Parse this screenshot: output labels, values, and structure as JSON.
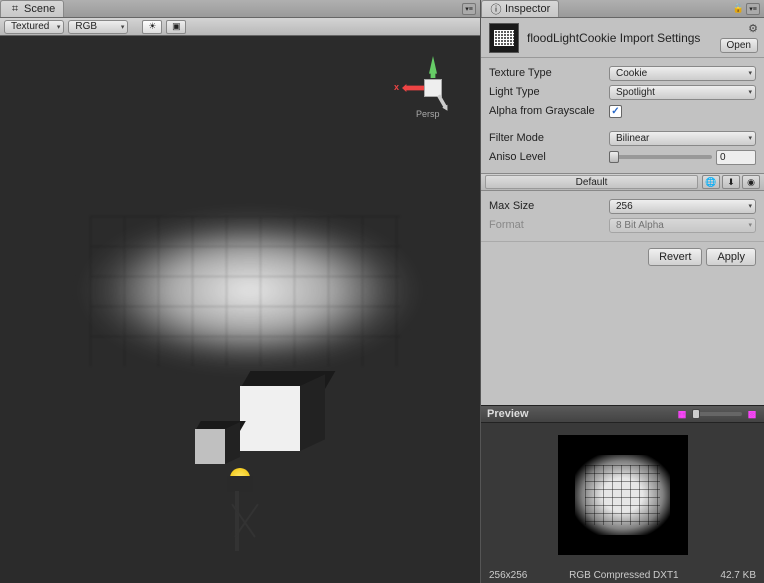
{
  "scene": {
    "tab_label": "Scene",
    "render_mode": "Textured",
    "color_mode": "RGB",
    "gizmo_label": "Persp",
    "gizmo_x": "x"
  },
  "inspector": {
    "tab_label": "Inspector",
    "asset_name": "floodLightCookie Import Settings",
    "open_label": "Open",
    "fields": {
      "texture_type": {
        "label": "Texture Type",
        "value": "Cookie"
      },
      "light_type": {
        "label": "Light Type",
        "value": "Spotlight"
      },
      "alpha_grayscale": {
        "label": "Alpha from Grayscale",
        "checked": "✓"
      },
      "filter_mode": {
        "label": "Filter Mode",
        "value": "Bilinear"
      },
      "aniso": {
        "label": "Aniso Level",
        "value": "0"
      },
      "max_size": {
        "label": "Max Size",
        "value": "256"
      },
      "format": {
        "label": "Format",
        "value": "8 Bit Alpha"
      }
    },
    "platform_default": "Default",
    "revert": "Revert",
    "apply": "Apply"
  },
  "preview": {
    "label": "Preview",
    "dimensions": "256x256",
    "format": "RGB Compressed DXT1",
    "size": "42.7 KB"
  }
}
